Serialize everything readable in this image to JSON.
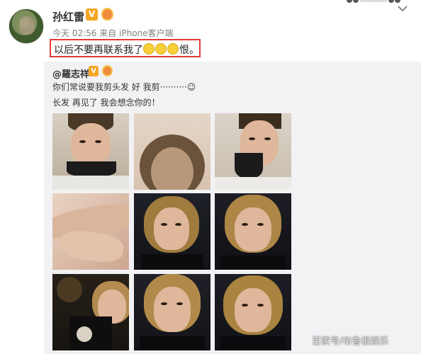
{
  "post": {
    "username": "孙红雷",
    "verified_badge": "V",
    "meta": "今天 02:56 来自 iPhone客户端",
    "text_before": "以后不要再联系我了",
    "text_after": "恨。",
    "emoji_name": "sad-face-emoji",
    "highlight_color": "#e13c3c"
  },
  "repost": {
    "username": "@羅志祥",
    "verified_badge": "V",
    "line1": "你们常说要我剪头发 好 我剪··········☺",
    "line2": "长发 再见了 我会想念你的！",
    "photos": [
      {
        "name": "photo-1"
      },
      {
        "name": "photo-2"
      },
      {
        "name": "photo-3"
      },
      {
        "name": "photo-4"
      },
      {
        "name": "photo-5"
      },
      {
        "name": "photo-6"
      },
      {
        "name": "photo-7"
      },
      {
        "name": "photo-8"
      },
      {
        "name": "photo-9"
      }
    ]
  },
  "watermark": "百家号/布鲁根娱乐",
  "colors": {
    "accent_badge": "#f5a623",
    "repost_bg": "#f2f2f5"
  },
  "icons": {
    "expand": "chevron-down-icon",
    "verified": "verified-v-icon",
    "medal": "medal-icon"
  }
}
